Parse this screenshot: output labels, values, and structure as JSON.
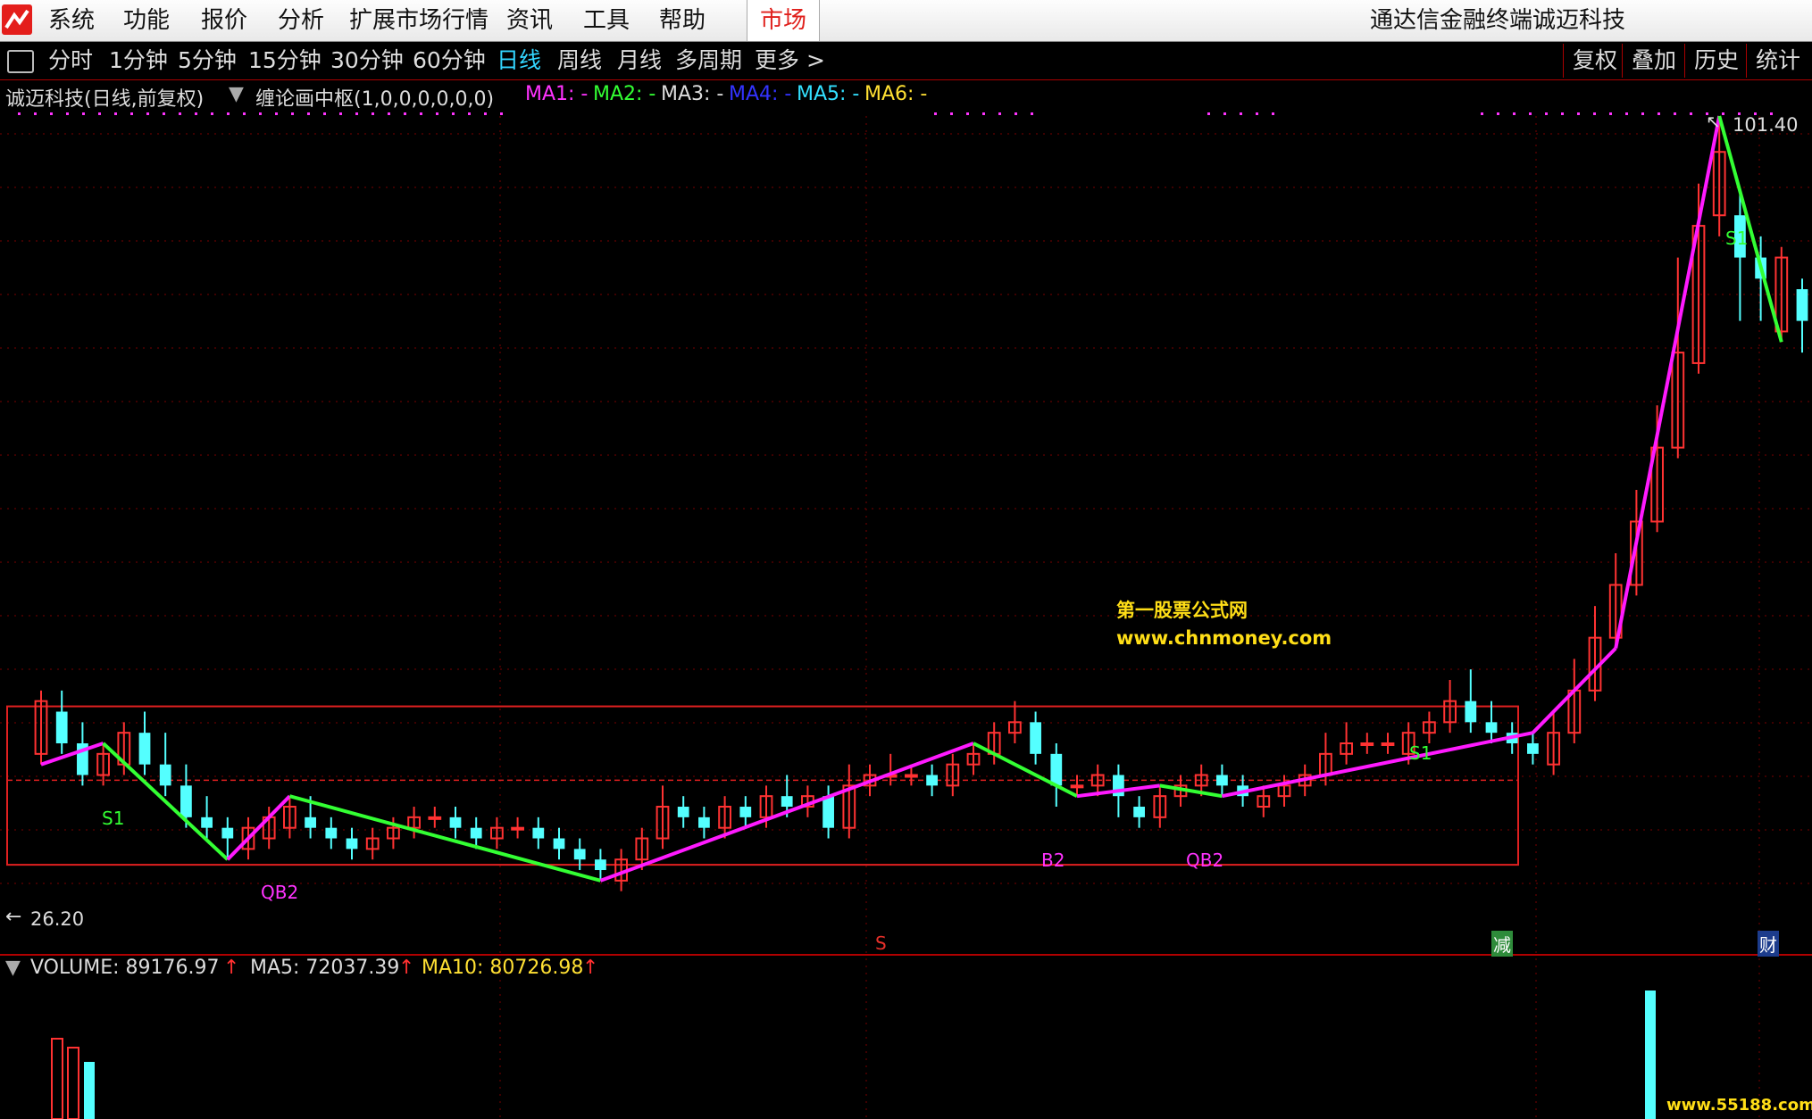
{
  "menubar": {
    "items": [
      "系统",
      "功能",
      "报价",
      "分析",
      "扩展市场行情",
      "资讯",
      "工具",
      "帮助"
    ],
    "active": "市场",
    "app_title": "通达信金融终端",
    "stock_title": "诚迈科技"
  },
  "toolbar": {
    "periods": [
      "分时",
      "1分钟",
      "5分钟",
      "15分钟",
      "30分钟",
      "60分钟",
      "日线",
      "周线",
      "月线",
      "多周期",
      "更多 >"
    ],
    "selected": "日线",
    "right_buttons": [
      "复权",
      "叠加",
      "历史",
      "统计"
    ]
  },
  "indicator_header": {
    "stock": "诚迈科技(日线,前复权)",
    "formula": "缠论画中枢(1,0,0,0,0,0,0)",
    "ma": [
      {
        "label": "MA1: -",
        "color": "#ff33ff"
      },
      {
        "label": "MA2: -",
        "color": "#33ff33"
      },
      {
        "label": "MA3: -",
        "color": "#dddddd"
      },
      {
        "label": "MA4: -",
        "color": "#3333ff"
      },
      {
        "label": "MA5: -",
        "color": "#33e0ff"
      },
      {
        "label": "MA6: -",
        "color": "#ffe033"
      }
    ]
  },
  "price_labels": {
    "high": "101.40",
    "low": "26.20"
  },
  "signal_labels": {
    "qb2_a": "QB2",
    "b2": "B2",
    "qb2_b": "QB2",
    "s1_a": "S1",
    "s1_b": "S1",
    "s1_c": "S1"
  },
  "event_markers": {
    "s": "S",
    "jian": "减",
    "cai": "财"
  },
  "watermark": {
    "name": "第一股票公式网",
    "url": "www.chnmoney.com",
    "corner": "www.55188.com"
  },
  "volume_legend": {
    "volume": "VOLUME: 89176.97",
    "ma5": "MA5: 72037.39",
    "ma10": "MA10: 80726.98"
  },
  "chart_data": {
    "type": "candlestick",
    "price_range": [
      26.2,
      101.4
    ],
    "candles": [
      {
        "o": 41,
        "c": 46,
        "h": 47,
        "l": 40
      },
      {
        "o": 45,
        "c": 42,
        "h": 47,
        "l": 41
      },
      {
        "o": 42,
        "c": 39,
        "h": 44,
        "l": 38
      },
      {
        "o": 39,
        "c": 41,
        "h": 42,
        "l": 38
      },
      {
        "o": 40,
        "c": 43,
        "h": 44,
        "l": 39
      },
      {
        "o": 43,
        "c": 40,
        "h": 45,
        "l": 39
      },
      {
        "o": 40,
        "c": 38,
        "h": 43,
        "l": 37
      },
      {
        "o": 38,
        "c": 35,
        "h": 40,
        "l": 34
      },
      {
        "o": 35,
        "c": 34,
        "h": 37,
        "l": 33
      },
      {
        "o": 34,
        "c": 33,
        "h": 35,
        "l": 31
      },
      {
        "o": 32,
        "c": 34,
        "h": 35,
        "l": 31
      },
      {
        "o": 33,
        "c": 35,
        "h": 36,
        "l": 32
      },
      {
        "o": 34,
        "c": 36,
        "h": 37,
        "l": 33
      },
      {
        "o": 35,
        "c": 34,
        "h": 37,
        "l": 33
      },
      {
        "o": 34,
        "c": 33,
        "h": 35,
        "l": 32
      },
      {
        "o": 33,
        "c": 32,
        "h": 34,
        "l": 31
      },
      {
        "o": 32,
        "c": 33,
        "h": 34,
        "l": 31
      },
      {
        "o": 33,
        "c": 34,
        "h": 35,
        "l": 32
      },
      {
        "o": 34,
        "c": 35,
        "h": 36,
        "l": 33
      },
      {
        "o": 35,
        "c": 35,
        "h": 36,
        "l": 34
      },
      {
        "o": 35,
        "c": 34,
        "h": 36,
        "l": 33
      },
      {
        "o": 34,
        "c": 33,
        "h": 35,
        "l": 32
      },
      {
        "o": 33,
        "c": 34,
        "h": 35,
        "l": 32
      },
      {
        "o": 34,
        "c": 34,
        "h": 35,
        "l": 33
      },
      {
        "o": 34,
        "c": 33,
        "h": 35,
        "l": 32
      },
      {
        "o": 33,
        "c": 32,
        "h": 34,
        "l": 31
      },
      {
        "o": 32,
        "c": 31,
        "h": 33,
        "l": 30
      },
      {
        "o": 31,
        "c": 30,
        "h": 32,
        "l": 29
      },
      {
        "o": 29,
        "c": 31,
        "h": 32,
        "l": 28
      },
      {
        "o": 31,
        "c": 33,
        "h": 34,
        "l": 30
      },
      {
        "o": 33,
        "c": 36,
        "h": 38,
        "l": 32
      },
      {
        "o": 36,
        "c": 35,
        "h": 37,
        "l": 34
      },
      {
        "o": 35,
        "c": 34,
        "h": 36,
        "l": 33
      },
      {
        "o": 34,
        "c": 36,
        "h": 37,
        "l": 33
      },
      {
        "o": 36,
        "c": 35,
        "h": 37,
        "l": 34
      },
      {
        "o": 35,
        "c": 37,
        "h": 38,
        "l": 34
      },
      {
        "o": 37,
        "c": 36,
        "h": 39,
        "l": 35
      },
      {
        "o": 36,
        "c": 37,
        "h": 38,
        "l": 35
      },
      {
        "o": 37,
        "c": 34,
        "h": 38,
        "l": 33
      },
      {
        "o": 34,
        "c": 38,
        "h": 40,
        "l": 33
      },
      {
        "o": 38,
        "c": 39,
        "h": 40,
        "l": 37
      },
      {
        "o": 39,
        "c": 39,
        "h": 41,
        "l": 38
      },
      {
        "o": 39,
        "c": 39,
        "h": 40,
        "l": 38
      },
      {
        "o": 39,
        "c": 38,
        "h": 40,
        "l": 37
      },
      {
        "o": 38,
        "c": 40,
        "h": 41,
        "l": 37
      },
      {
        "o": 40,
        "c": 41,
        "h": 42,
        "l": 39
      },
      {
        "o": 41,
        "c": 43,
        "h": 44,
        "l": 40
      },
      {
        "o": 43,
        "c": 44,
        "h": 46,
        "l": 42
      },
      {
        "o": 44,
        "c": 41,
        "h": 45,
        "l": 40
      },
      {
        "o": 41,
        "c": 38,
        "h": 42,
        "l": 36
      },
      {
        "o": 38,
        "c": 38,
        "h": 39,
        "l": 37
      },
      {
        "o": 38,
        "c": 39,
        "h": 40,
        "l": 37
      },
      {
        "o": 39,
        "c": 37,
        "h": 40,
        "l": 35
      },
      {
        "o": 36,
        "c": 35,
        "h": 37,
        "l": 34
      },
      {
        "o": 35,
        "c": 37,
        "h": 38,
        "l": 34
      },
      {
        "o": 37,
        "c": 38,
        "h": 39,
        "l": 36
      },
      {
        "o": 38,
        "c": 39,
        "h": 40,
        "l": 37
      },
      {
        "o": 39,
        "c": 38,
        "h": 40,
        "l": 37
      },
      {
        "o": 38,
        "c": 37,
        "h": 39,
        "l": 36
      },
      {
        "o": 36,
        "c": 37,
        "h": 38,
        "l": 35
      },
      {
        "o": 37,
        "c": 38,
        "h": 39,
        "l": 36
      },
      {
        "o": 38,
        "c": 39,
        "h": 40,
        "l": 37
      },
      {
        "o": 39,
        "c": 41,
        "h": 43,
        "l": 38
      },
      {
        "o": 41,
        "c": 42,
        "h": 44,
        "l": 40
      },
      {
        "o": 42,
        "c": 42,
        "h": 43,
        "l": 41
      },
      {
        "o": 42,
        "c": 42,
        "h": 43,
        "l": 41
      },
      {
        "o": 41,
        "c": 43,
        "h": 44,
        "l": 40
      },
      {
        "o": 43,
        "c": 44,
        "h": 45,
        "l": 42
      },
      {
        "o": 44,
        "c": 46,
        "h": 48,
        "l": 43
      },
      {
        "o": 46,
        "c": 44,
        "h": 49,
        "l": 43
      },
      {
        "o": 44,
        "c": 43,
        "h": 46,
        "l": 42
      },
      {
        "o": 43,
        "c": 42,
        "h": 44,
        "l": 41
      },
      {
        "o": 42,
        "c": 41,
        "h": 43,
        "l": 40
      },
      {
        "o": 40,
        "c": 43,
        "h": 45,
        "l": 39
      },
      {
        "o": 43,
        "c": 47,
        "h": 50,
        "l": 42
      },
      {
        "o": 47,
        "c": 52,
        "h": 55,
        "l": 46
      },
      {
        "o": 52,
        "c": 57,
        "h": 60,
        "l": 51
      },
      {
        "o": 57,
        "c": 63,
        "h": 66,
        "l": 56
      },
      {
        "o": 63,
        "c": 70,
        "h": 74,
        "l": 62
      },
      {
        "o": 70,
        "c": 79,
        "h": 88,
        "l": 69
      },
      {
        "o": 78,
        "c": 91,
        "h": 95,
        "l": 77
      },
      {
        "o": 92,
        "c": 98,
        "h": 101.4,
        "l": 90
      },
      {
        "o": 92,
        "c": 88,
        "h": 94,
        "l": 82
      },
      {
        "o": 88,
        "c": 86,
        "h": 90,
        "l": 82
      },
      {
        "o": 81,
        "c": 88,
        "h": 89,
        "l": 80
      },
      {
        "o": 85,
        "c": 82,
        "h": 86,
        "l": 79
      }
    ]
  }
}
